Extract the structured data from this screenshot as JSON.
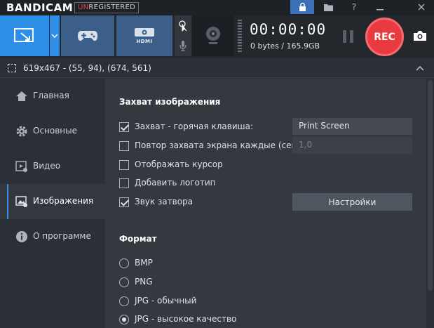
{
  "app": {
    "brand": "BANDICAM",
    "badge_un": "UN",
    "badge_rest": "REGISTERED"
  },
  "toolbar": {
    "timer": "00:00:00",
    "size": "0 bytes / 165.9GB",
    "rec_label": "REC",
    "hdmi_label": "HDMI"
  },
  "region": {
    "text": "619x467 - (55, 94), (674, 561)"
  },
  "sidebar": {
    "items": [
      {
        "label": "Главная",
        "icon": "home-icon"
      },
      {
        "label": "Основные",
        "icon": "gear-icon"
      },
      {
        "label": "Видео",
        "icon": "video-icon"
      },
      {
        "label": "Изображения",
        "icon": "image-settings-icon"
      },
      {
        "label": "О программе",
        "icon": "info-icon"
      }
    ],
    "active_index": 3
  },
  "capture": {
    "title": "Захват изображения",
    "hotkey_label": "Захват - горячая клавиша:",
    "hotkey_value": "Print Screen",
    "repeat_label": "Повтор захвата экрана каждые (сек.)",
    "repeat_value": "1,0",
    "cursor_label": "Отображать курсор",
    "logo_label": "Добавить логотип",
    "shutter_label": "Звук затвора",
    "settings_button": "Настройки"
  },
  "format": {
    "title": "Формат",
    "options": [
      "BMP",
      "PNG",
      "JPG - обычный",
      "JPG - высокое качество"
    ],
    "selected_index": 3
  },
  "colors": {
    "accent": "#2e8fe8",
    "rec": "#e83a3f",
    "panel": "#34383f"
  }
}
